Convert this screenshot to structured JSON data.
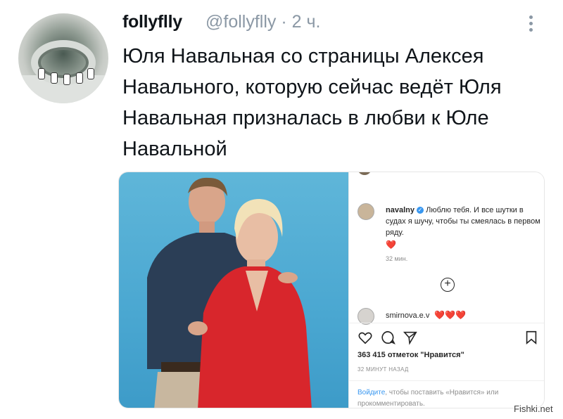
{
  "tweet": {
    "display_name": "follyflly",
    "handle_time": "@follyflly · 2 ч.",
    "text": "Юля Навальная со страницы Алексея Навального, которую сейчас ведёт Юля Навальная призналась в любви к Юле Навальной",
    "more_icon": "vertical-ellipsis-icon"
  },
  "instagram": {
    "comment_user": "navalny",
    "comment_text": "Люблю тебя. И все шутки в судах я шучу, чтобы ты смеялась в первом ряду.",
    "comment_heart": "❤️",
    "comment_time": "32 мин.",
    "reply_user": "smirnova.e.v",
    "reply_hearts": "❤️❤️❤️",
    "likes": "363 415 отметок \"Нравится\"",
    "posted_ago": "32 МИНУТ НАЗАД",
    "login_link": "Войдите",
    "login_rest": ", чтобы поставить «Нравится» или прокомментировать."
  },
  "watermark": "Fishki.net",
  "colors": {
    "handle_gray": "#8b98a5",
    "ig_link_blue": "#3897f0",
    "heart_red": "#ed4956",
    "photo_bg": "#4aa7d1"
  }
}
